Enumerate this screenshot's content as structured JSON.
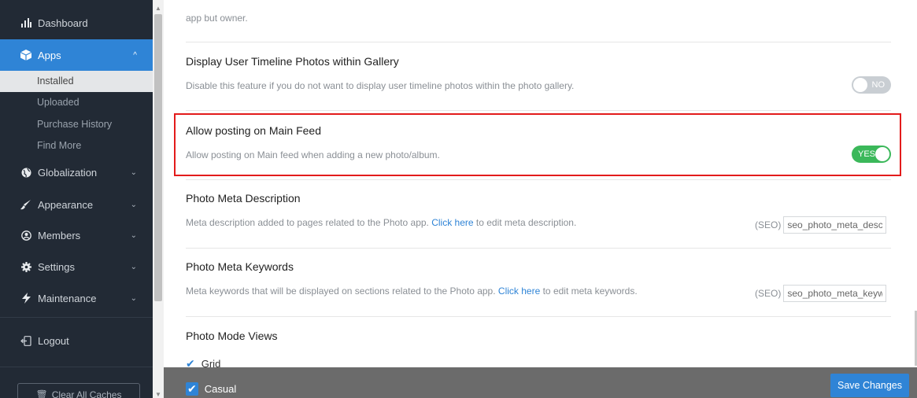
{
  "sidebar": {
    "items": [
      {
        "label": "Dashboard",
        "icon": "bar-chart-icon"
      },
      {
        "label": "Apps",
        "icon": "cube-icon"
      },
      {
        "label": "Globalization",
        "icon": "globe-icon"
      },
      {
        "label": "Appearance",
        "icon": "brush-icon"
      },
      {
        "label": "Members",
        "icon": "user-circle-icon"
      },
      {
        "label": "Settings",
        "icon": "gear-icon"
      },
      {
        "label": "Maintenance",
        "icon": "bolt-icon"
      },
      {
        "label": "Logout",
        "icon": "logout-icon"
      }
    ],
    "apps_sub": [
      "Installed",
      "Uploaded",
      "Purchase History",
      "Find More"
    ],
    "clear_cache_label": "Clear All Caches"
  },
  "main": {
    "top_desc": "app but owner.",
    "timeline": {
      "title": "Display User Timeline Photos within Gallery",
      "desc": "Disable this feature if you do not want to display user timeline photos within the photo gallery.",
      "toggle_label": "NO"
    },
    "main_feed": {
      "title": "Allow posting on Main Feed",
      "desc": "Allow posting on Main feed when adding a new photo/album.",
      "toggle_label": "YES"
    },
    "meta_desc": {
      "title": "Photo Meta Description",
      "desc_before": "Meta description added to pages related to the Photo app. ",
      "link": "Click here",
      "desc_after": " to edit meta description.",
      "seo_label": "(SEO)",
      "seo_value": "seo_photo_meta_descri"
    },
    "meta_keywords": {
      "title": "Photo Meta Keywords",
      "desc_before": "Meta keywords that will be displayed on sections related to the Photo app. ",
      "link": "Click here",
      "desc_after": " to edit meta keywords.",
      "seo_label": "(SEO)",
      "seo_value": "seo_photo_meta_keywc"
    },
    "mode_views": {
      "title": "Photo Mode Views",
      "options": [
        "Grid",
        "Casual"
      ]
    }
  },
  "footer": {
    "save_label": "Save Changes"
  }
}
